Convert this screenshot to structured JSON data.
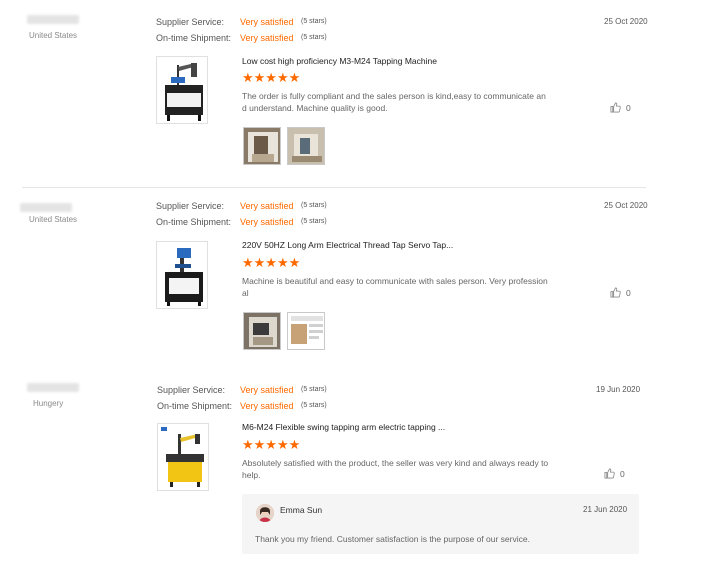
{
  "labels": {
    "supplier_service": "Supplier Service:",
    "ontime_shipment": "On-time Shipment:"
  },
  "reviews": [
    {
      "country": "United States",
      "supplier_service": "Very satisfied",
      "supplier_stars": "(5 stars)",
      "shipment": "Very satisfied",
      "shipment_stars": "(5 stars)",
      "date": "25 Oct 2020",
      "product_title": "Low cost high proficiency M3-M24 Tapping Machine",
      "rating": "★★★★★",
      "text_line1": "The order is fully compliant and the sales person is kind,easy to communicate an",
      "text_line2": "d understand. Machine quality is good.",
      "likes": "0"
    },
    {
      "country": "United States",
      "supplier_service": "Very satisfied",
      "supplier_stars": "(5 stars)",
      "shipment": "Very satisfied",
      "shipment_stars": "(5 stars)",
      "date": "25 Oct 2020",
      "product_title": "220V 50HZ Long Arm Electrical Thread Tap Servo Tap...",
      "rating": "★★★★★",
      "text_line1": "Machine is beautiful and easy to communicate with sales person. Very profession",
      "text_line2": "al",
      "likes": "0"
    },
    {
      "country": "Hungery",
      "supplier_service": "Very satisfied",
      "supplier_stars": "(5 stars)",
      "shipment": "Very satisfied",
      "shipment_stars": "(5 stars)",
      "date": "19 Jun 2020",
      "product_title": "M6-M24 Flexible swing tapping arm electric tapping ...",
      "rating": "★★★★★",
      "text_line1": "Absolutely satisfied with the product, the seller was very kind and always ready to",
      "text_line2": "help.",
      "likes": "0",
      "reply": {
        "name": "Emma Sun",
        "date": "21 Jun 2020",
        "text": "Thank you my friend. Customer satisfaction is the purpose of our service."
      }
    }
  ],
  "colors": {
    "accent": "#ff6a00",
    "divider": "#e6e6e6",
    "reply_bg": "#f5f5f5"
  },
  "icons": {
    "like": "thumbs-up-icon"
  }
}
